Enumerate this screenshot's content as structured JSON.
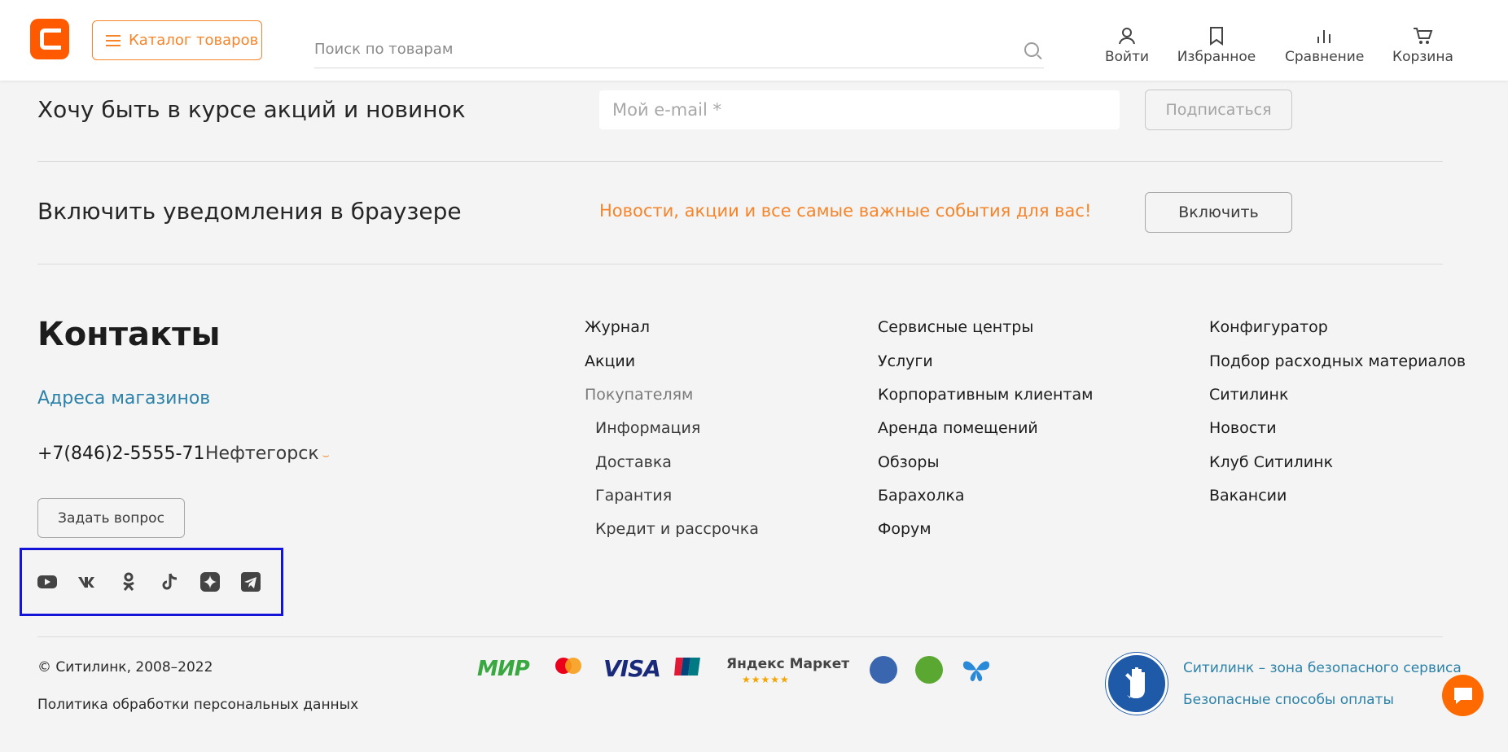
{
  "header": {
    "catalog_label": "Каталог товаров",
    "search_placeholder": "Поиск по товарам",
    "actions": [
      {
        "label": "Войти",
        "icon": "user-icon"
      },
      {
        "label": "Избранное",
        "icon": "bookmark-icon"
      },
      {
        "label": "Сравнение",
        "icon": "compare-icon"
      },
      {
        "label": "Корзина",
        "icon": "cart-icon"
      }
    ]
  },
  "subscribe": {
    "title": "Хочу быть в курсе акций и новинок",
    "email_placeholder": "Мой e-mail *",
    "button_label": "Подписаться"
  },
  "notifications": {
    "title": "Включить уведомления в браузере",
    "text": "Новости, акции и все самые важные события для вас!",
    "button_label": "Включить"
  },
  "contacts": {
    "title": "Контакты",
    "stores_link": "Адреса магазинов",
    "phone": "+7(846)2-5555-71",
    "city": "Нефтегорск",
    "ask_button": "Задать вопрос",
    "social": [
      "youtube-icon",
      "vk-icon",
      "odnoklassniki-icon",
      "tiktok-icon",
      "zen-icon",
      "telegram-icon"
    ]
  },
  "columns": {
    "col1": [
      "Журнал",
      "Акции",
      "Покупателям",
      "Информация",
      "Доставка",
      "Гарантия",
      "Кредит и рассрочка"
    ],
    "col2": [
      "Сервисные центры",
      "Услуги",
      "Корпоративным клиентам",
      "Аренда помещений",
      "Обзоры",
      "Барахолка",
      "Форум"
    ],
    "col3": [
      "Конфигуратор",
      "Подбор расходных материалов",
      "Ситилинк",
      "Новости",
      "Клуб Ситилинк",
      "Вакансии"
    ]
  },
  "footer": {
    "copyright": "© Ситилинк, 2008–2022",
    "policy": "Политика обработки персональных данных",
    "payments": {
      "mir": "МИР",
      "visa": "VISA",
      "yandex_market": "Яндекс Маркет"
    },
    "safe_zone": "Ситилинк – зона безопасного сервиса",
    "safe_payment": "Безопасные способы оплаты"
  },
  "colors": {
    "accent": "#f5842a",
    "brand": "#ff5a00",
    "link": "#2c82a8",
    "highlight_box": "#1414d9"
  }
}
